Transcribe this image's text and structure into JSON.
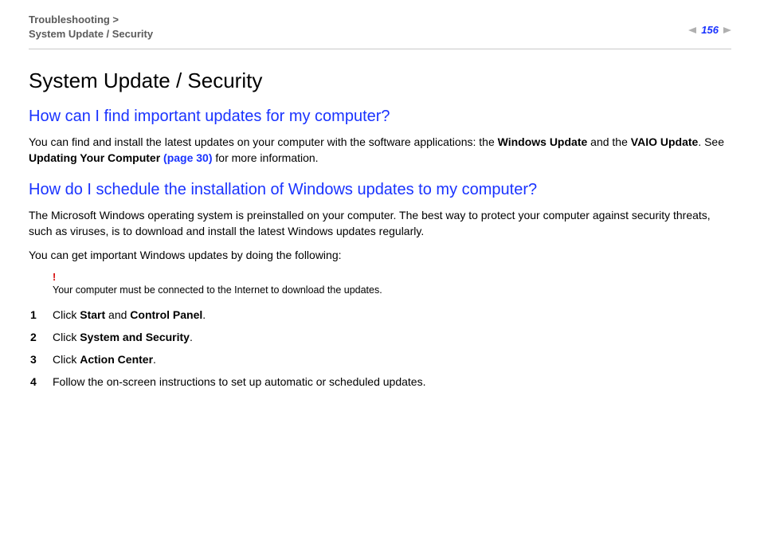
{
  "header": {
    "breadcrumb_line1": "Troubleshooting >",
    "breadcrumb_line2": "System Update / Security",
    "page_number": "156"
  },
  "main": {
    "title": "System Update / Security",
    "section1": {
      "heading": "How can I find important updates for my computer?",
      "p1_a": "You can find and install the latest updates on your computer with the software applications: the ",
      "p1_bold1": "Windows Update",
      "p1_b": " and the ",
      "p1_bold2": "VAIO Update",
      "p1_c": ". See ",
      "p1_bold3": "Updating Your Computer ",
      "p1_link": "(page 30)",
      "p1_d": " for more information."
    },
    "section2": {
      "heading": "How do I schedule the installation of Windows updates to my computer?",
      "p1": "The Microsoft Windows operating system is preinstalled on your computer. The best way to protect your computer against security threats, such as viruses, is to download and install the latest Windows updates regularly.",
      "p2": "You can get important Windows updates by doing the following:",
      "alert_mark": "!",
      "alert_text": "Your computer must be connected to the Internet to download the updates.",
      "steps": [
        {
          "n": "1",
          "pre": "Click ",
          "b1": "Start",
          "mid": " and ",
          "b2": "Control Panel",
          "post": "."
        },
        {
          "n": "2",
          "pre": "Click ",
          "b1": "System and Security",
          "mid": "",
          "b2": "",
          "post": "."
        },
        {
          "n": "3",
          "pre": "Click ",
          "b1": "Action Center",
          "mid": "",
          "b2": "",
          "post": "."
        },
        {
          "n": "4",
          "pre": "Follow the on-screen instructions to set up automatic or scheduled updates.",
          "b1": "",
          "mid": "",
          "b2": "",
          "post": ""
        }
      ]
    }
  }
}
